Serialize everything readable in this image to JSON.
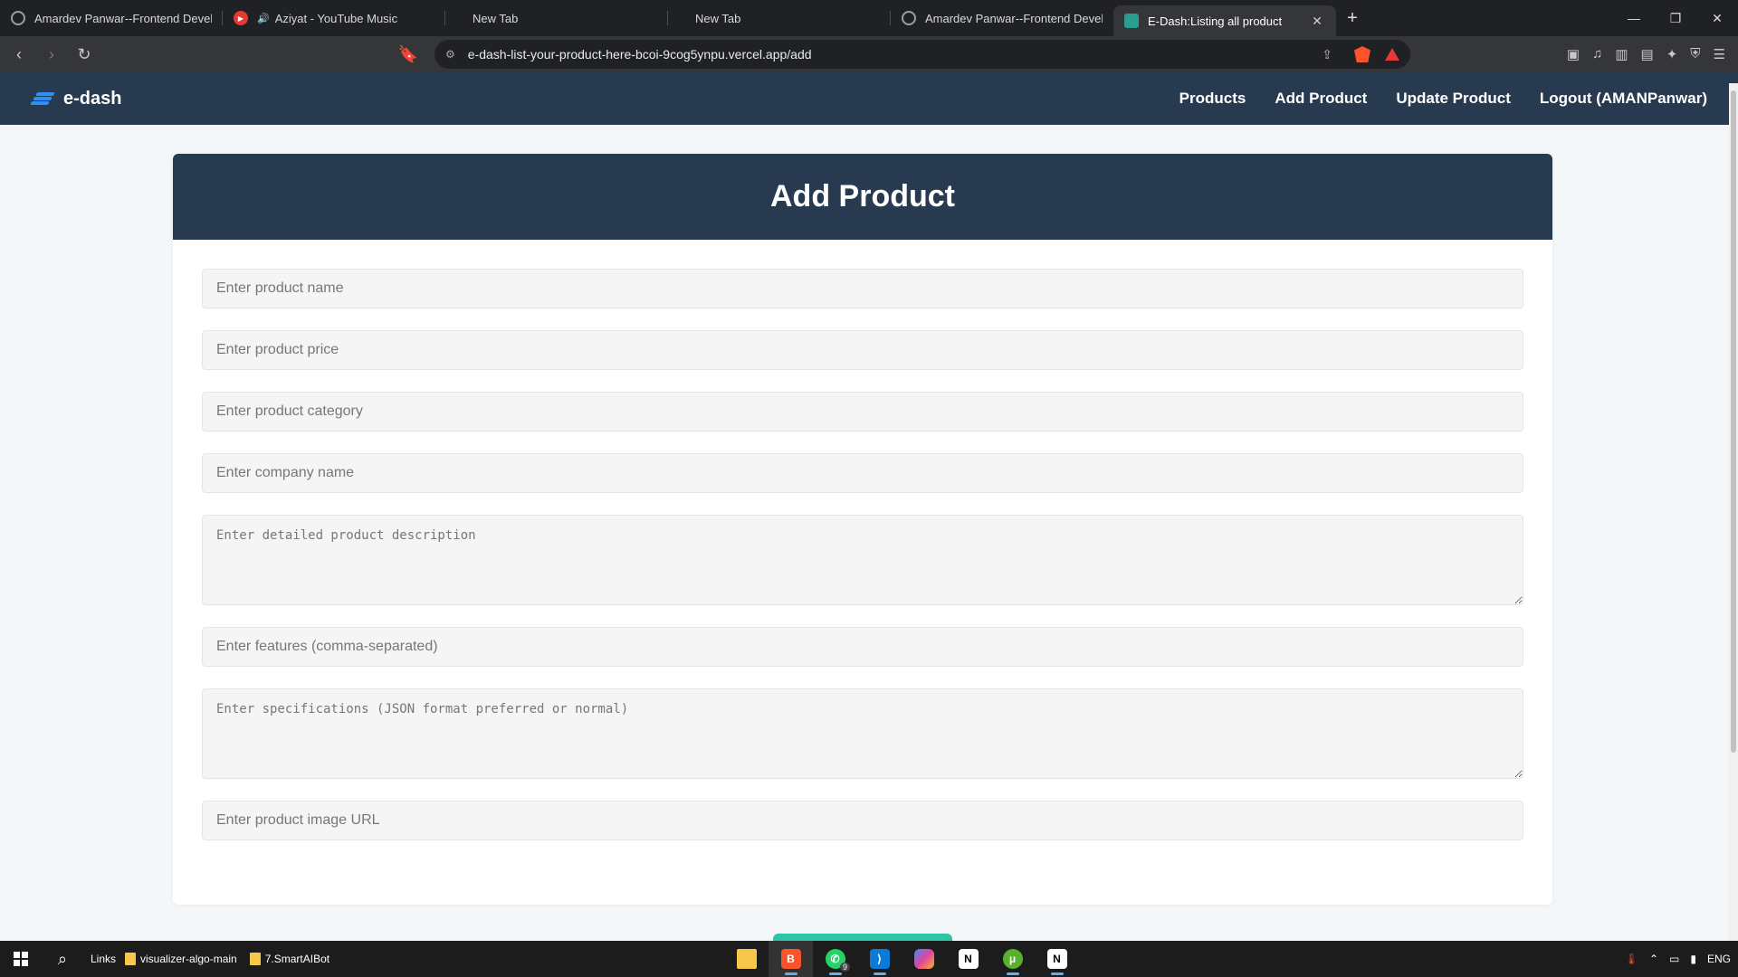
{
  "browser": {
    "tabs": [
      {
        "title": "Amardev Panwar--Frontend Develop",
        "icon": "globe-icon",
        "active": false
      },
      {
        "title": "Aziyat - YouTube Music",
        "icon": "youtube-music-icon",
        "active": false
      },
      {
        "title": "New Tab",
        "icon": "",
        "active": false
      },
      {
        "title": "New Tab",
        "icon": "",
        "active": false
      },
      {
        "title": "Amardev Panwar--Frontend Develop",
        "icon": "globe-icon",
        "active": false
      },
      {
        "title": "E-Dash:Listing all product",
        "icon": "site-icon",
        "active": true
      }
    ],
    "url": "e-dash-list-your-product-here-bcoi-9cog5ynpu.vercel.app/add"
  },
  "app": {
    "logo_text": "e-dash",
    "nav": {
      "products": "Products",
      "add_product": "Add Product",
      "update_product": "Update Product",
      "logout": "Logout (AMANPanwar)"
    },
    "form": {
      "title": "Add Product",
      "name_placeholder": "Enter product name",
      "price_placeholder": "Enter product price",
      "category_placeholder": "Enter product category",
      "company_placeholder": "Enter company name",
      "description_placeholder": "Enter detailed product description",
      "features_placeholder": "Enter features (comma-separated)",
      "specs_placeholder": "Enter specifications (JSON format preferred or normal)",
      "image_placeholder": "Enter product image URL"
    }
  },
  "taskbar": {
    "links_label": "Links",
    "folders": [
      "visualizer-algo-main",
      "7.SmartAIBot"
    ],
    "whatsapp_badge": "9",
    "tray_lang": "ENG"
  },
  "colors": {
    "nav_bg": "#283a4f",
    "accent": "#2f8ff4",
    "submit": "#2ec4a5"
  }
}
